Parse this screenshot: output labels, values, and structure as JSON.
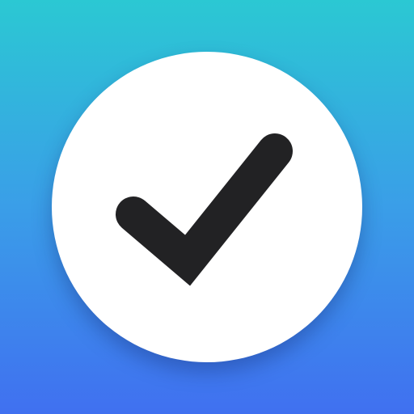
{
  "icon": {
    "name": "checkmark-icon",
    "colors": {
      "gradient_top": "#2bc8d3",
      "gradient_mid": "#3a9ee8",
      "gradient_bottom": "#4070f0",
      "disc": "#ffffff",
      "check": "#222224"
    }
  }
}
